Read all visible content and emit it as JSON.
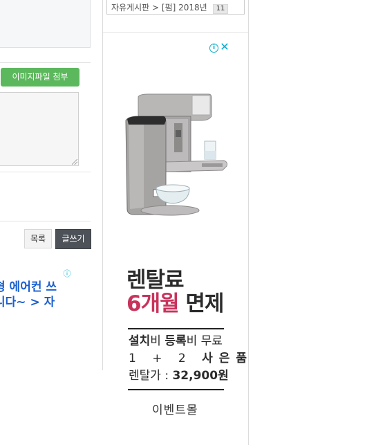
{
  "left": {
    "attach_button": "이미지파일 첨부",
    "list_button": "목록",
    "write_button": "글쓰기",
    "text_ad": {
      "info_icon": "info-icon",
      "line1": "형 에어컨 쓰",
      "line2": "니다~ > 자"
    }
  },
  "sidebar": {
    "hot_post": {
      "text": "자유게시판 > [펌] 2018년",
      "count": "11"
    },
    "ad": {
      "info_icon": "info-icon",
      "close_icon": "close-icon",
      "headline_line1": "렌탈료",
      "headline_pink": "6개월",
      "headline_rest": " 면제",
      "line1_bold1": "설치",
      "line1_normal1": "비 ",
      "line1_bold2": "등록",
      "line1_normal2": "비 무료",
      "line2_normal": "1 + 2 ",
      "line2_bold": "사은품",
      "line3_normal": "렌탈가 : ",
      "line3_bold": "32,900원",
      "shop_name": "이벤트몰"
    }
  },
  "colors": {
    "attach_button": "#5cb85c",
    "write_button": "#4d5259",
    "ad_accent": "#00aecd",
    "headline_pink": "#c8335b",
    "text_ad_blue": "#1a5fd0"
  }
}
